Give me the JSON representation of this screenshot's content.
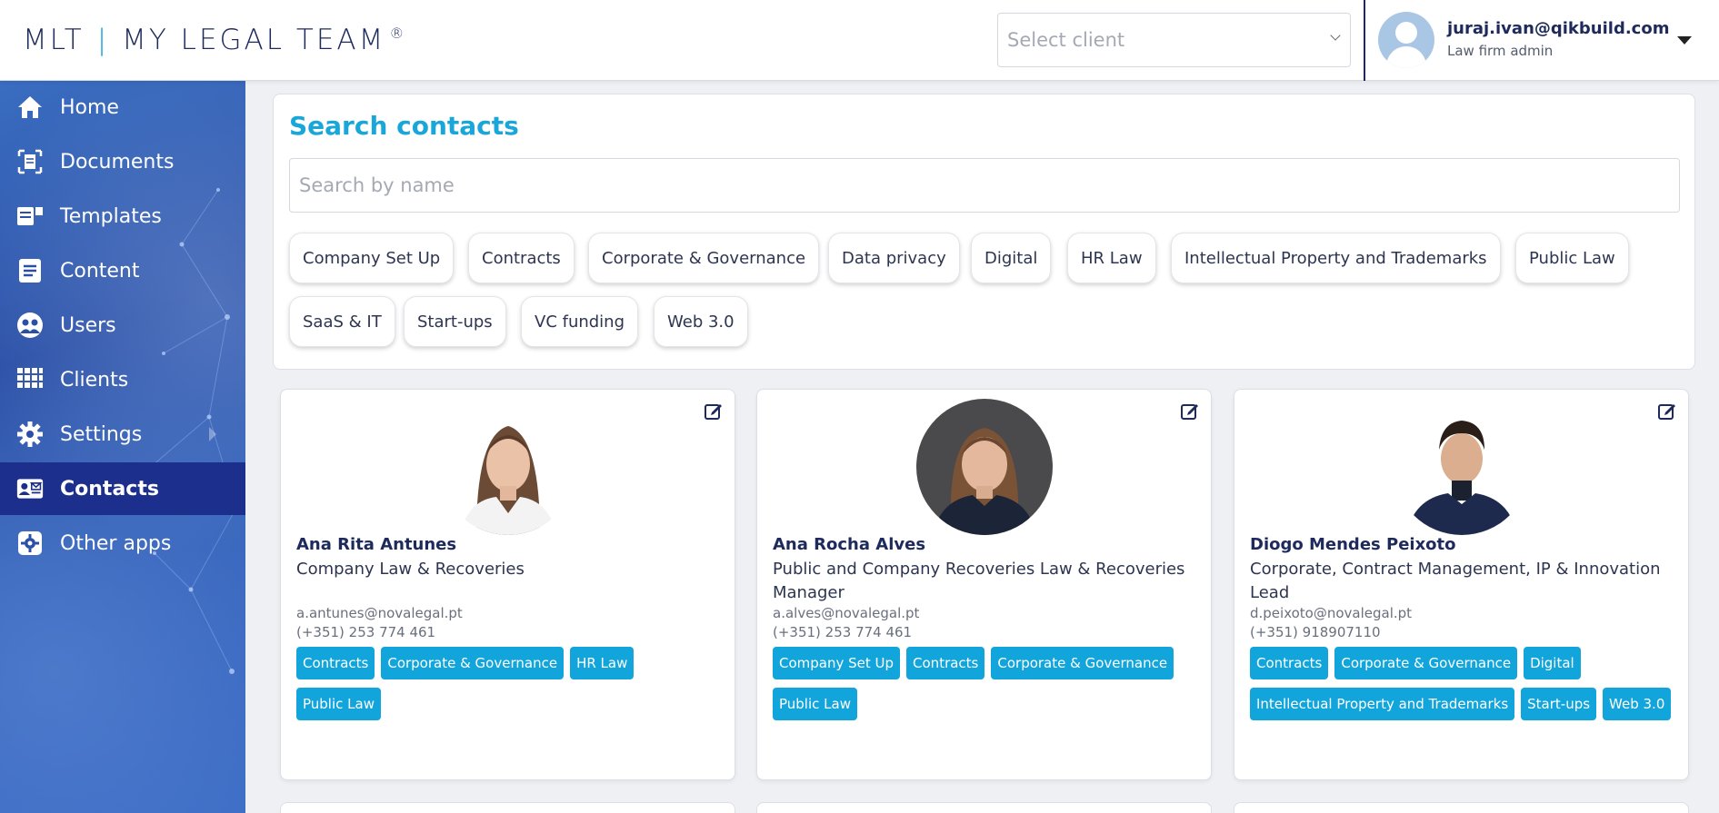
{
  "header": {
    "logo_left": "MLT",
    "logo_right": "MY LEGAL TEAM",
    "logo_reg": "®",
    "client_select_placeholder": "Select client",
    "user_email": "juraj.ivan@qikbuild.com",
    "user_role": "Law firm admin"
  },
  "sidebar": {
    "items": [
      {
        "label": "Home",
        "icon": "home-icon"
      },
      {
        "label": "Documents",
        "icon": "documents-icon"
      },
      {
        "label": "Templates",
        "icon": "templates-icon"
      },
      {
        "label": "Content",
        "icon": "content-icon"
      },
      {
        "label": "Users",
        "icon": "users-icon"
      },
      {
        "label": "Clients",
        "icon": "clients-icon"
      },
      {
        "label": "Settings",
        "icon": "settings-icon"
      },
      {
        "label": "Contacts",
        "icon": "contacts-icon",
        "active": true
      },
      {
        "label": "Other apps",
        "icon": "other-apps-icon"
      }
    ]
  },
  "search": {
    "title": "Search contacts",
    "placeholder": "Search by name",
    "tags": [
      "Company Set Up",
      "Contracts",
      "Corporate & Governance",
      "Data privacy",
      "Digital",
      "HR Law",
      "Intellectual Property and Trademarks",
      "Public Law",
      "SaaS & IT",
      "Start-ups",
      "VC funding",
      "Web 3.0"
    ]
  },
  "contacts": [
    {
      "name": "Ana Rita Antunes",
      "role": "Company Law & Recoveries",
      "email": "a.antunes@novalegal.pt",
      "phone": "(+351) 253 774 461",
      "tags": [
        "Contracts",
        "Corporate & Governance",
        "HR Law",
        "Public Law"
      ]
    },
    {
      "name": "Ana Rocha Alves",
      "role": "Public and Company Recoveries Law & Recoveries Manager",
      "email": "a.alves@novalegal.pt",
      "phone": "(+351) 253 774 461",
      "tags": [
        "Company Set Up",
        "Contracts",
        "Corporate & Governance",
        "Public Law"
      ]
    },
    {
      "name": "Diogo Mendes Peixoto",
      "role": "Corporate, Contract Management, IP & Innovation Lead",
      "email": "d.peixoto@novalegal.pt",
      "phone": "(+351) 918907110",
      "tags": [
        "Contracts",
        "Corporate & Governance",
        "Digital",
        "Intellectual Property and Trademarks",
        "Start-ups",
        "Web 3.0"
      ]
    }
  ],
  "colors": {
    "accent": "#19a6d8",
    "navy": "#1d2a5b",
    "sidebar_active": "#1c2f8c"
  }
}
